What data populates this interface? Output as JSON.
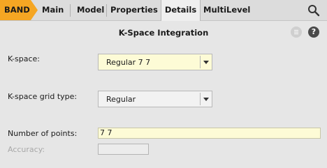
{
  "app": {
    "badge": "BAND",
    "badge_color": "#f5a623"
  },
  "tabs": [
    {
      "label": "Main"
    },
    {
      "label": "Model"
    },
    {
      "label": "Properties"
    },
    {
      "label": "Details",
      "active": true
    },
    {
      "label": "MultiLevel"
    }
  ],
  "panel": {
    "title": "K-Space Integration",
    "menu_icon": "menu-icon",
    "help_icon": "help-icon",
    "help_glyph": "?"
  },
  "form": {
    "kspace": {
      "label": "K-space:",
      "value": "Regular 7 7",
      "bg": "#fdfbd6"
    },
    "grid_type": {
      "label": "K-space grid type:",
      "value": "Regular",
      "bg": "#f2f2f2"
    },
    "num_points": {
      "label": "Number of points:",
      "value": "7 7"
    },
    "accuracy": {
      "label": "Accuracy:",
      "value": ""
    }
  }
}
